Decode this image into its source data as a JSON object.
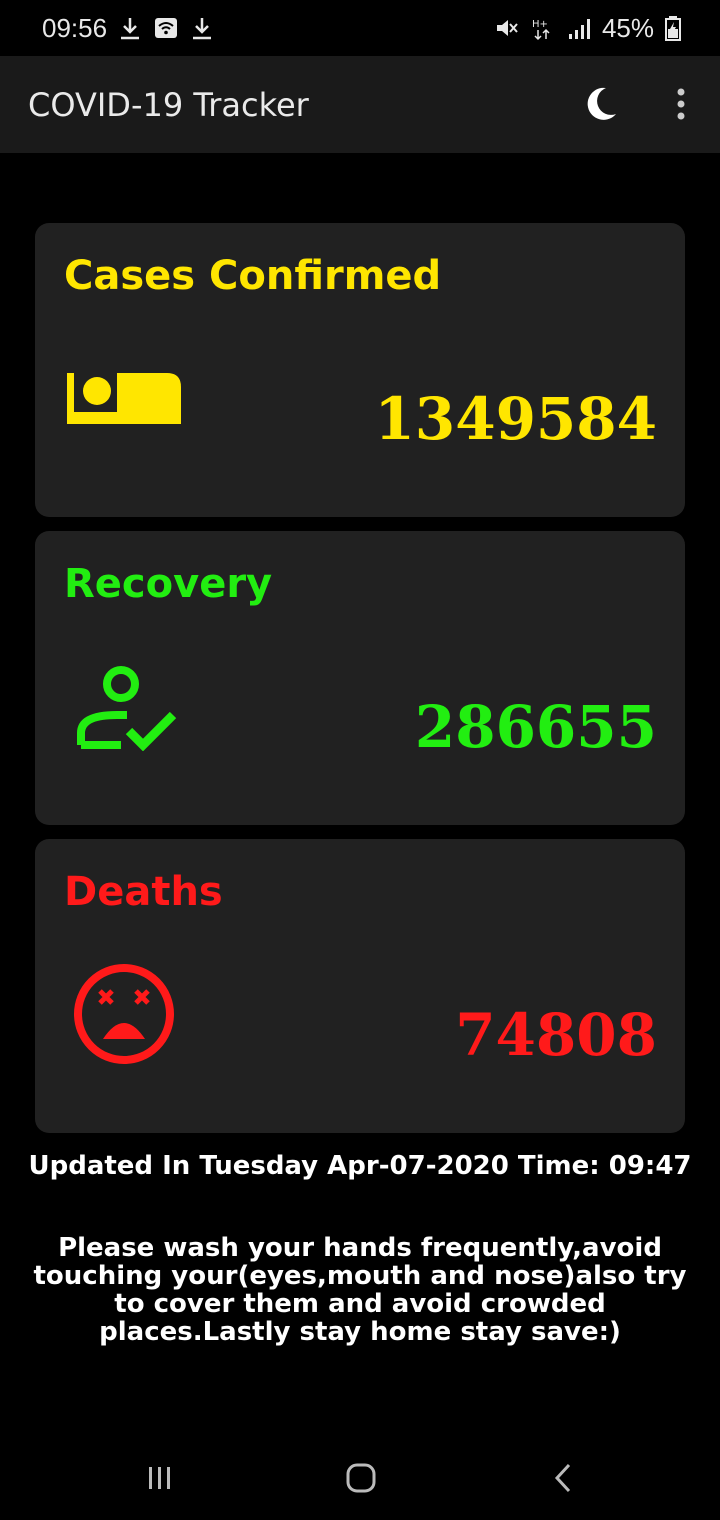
{
  "status_bar": {
    "time": "09:56",
    "battery": "45%"
  },
  "app_bar": {
    "title": "COVID-19 Tracker",
    "icons": [
      "moon-icon",
      "more-vert-icon"
    ]
  },
  "cards": [
    {
      "label": "Cases Confirmed",
      "value": "1349584",
      "color": "#FFE600",
      "icon": "bed-icon"
    },
    {
      "label": "Recovery",
      "value": "286655",
      "color": "#22EE11",
      "icon": "person-check-icon"
    },
    {
      "label": "Deaths",
      "value": "74808",
      "color": "#FF1A1A",
      "icon": "dead-face-icon"
    }
  ],
  "footer": {
    "updated": "Updated In Tuesday Apr-07-2020 Time: 09:47",
    "advice": "Please wash your hands frequently,avoid touching your(eyes,mouth and nose)also try to cover them and avoid crowded places.Lastly stay home stay save:)"
  },
  "nav_bar": {
    "icons": [
      "recents-icon",
      "home-icon",
      "back-icon"
    ]
  }
}
